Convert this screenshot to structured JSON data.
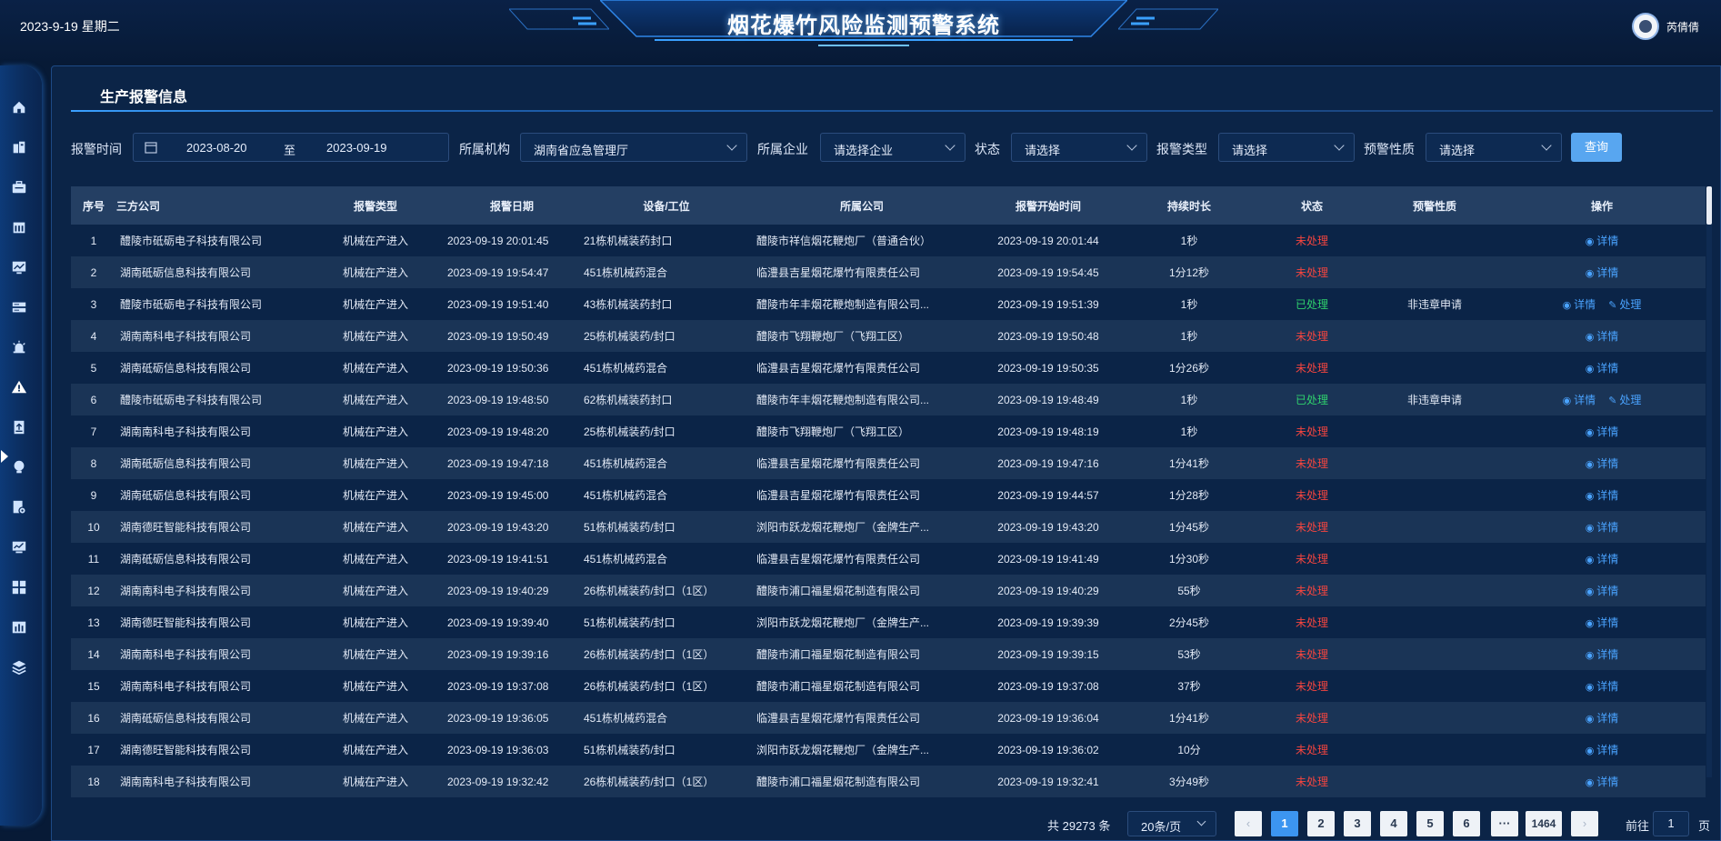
{
  "header": {
    "date": "2023-9-19 星期二",
    "title": "烟花爆竹风险监测预警系统",
    "username": "芮倩倩"
  },
  "sidebar": {
    "icons": [
      "home-icon",
      "building-icon",
      "briefcase-icon",
      "calendar-icon",
      "monitor-icon",
      "server-icon",
      "alarm-light-icon",
      "warning-icon",
      "document-upload-icon",
      "lightbulb-icon",
      "file-settings-icon",
      "dashboard-icon",
      "grid-icon",
      "bar-chart-icon",
      "layers-icon"
    ],
    "active_index": 7
  },
  "page": {
    "title": "生产报警信息"
  },
  "filters": {
    "time_label": "报警时间",
    "date_start": "2023-08-20",
    "date_sep": "至",
    "date_end": "2023-09-19",
    "org_label": "所属机构",
    "org_value": "湖南省应急管理厅",
    "company_label": "所属企业",
    "company_placeholder": "请选择企业",
    "status_label": "状态",
    "status_placeholder": "请选择",
    "type_label": "报警类型",
    "type_placeholder": "请选择",
    "nature_label": "预警性质",
    "nature_placeholder": "请选择",
    "query_button": "查询"
  },
  "table": {
    "columns": [
      "序号",
      "三方公司",
      "报警类型",
      "报警日期",
      "设备/工位",
      "所属公司",
      "报警开始时间",
      "持续时长",
      "状态",
      "预警性质",
      "操作"
    ],
    "detail_label": "详情",
    "process_label": "处理",
    "rows": [
      {
        "no": "1",
        "vendor": "醴陵市砥砺电子科技有限公司",
        "type": "机械在产进入",
        "date": "2023-09-19 20:01:45",
        "device": "21栋机械装药封口",
        "company": "醴陵市祥信烟花鞭炮厂（普通合伙）",
        "start": "2023-09-19 20:01:44",
        "duration": "1秒",
        "status": "未处理",
        "nature": ""
      },
      {
        "no": "2",
        "vendor": "湖南砥砺信息科技有限公司",
        "type": "机械在产进入",
        "date": "2023-09-19 19:54:47",
        "device": "451栋机械药混合",
        "company": "临澧县吉星烟花爆竹有限责任公司",
        "start": "2023-09-19 19:54:45",
        "duration": "1分12秒",
        "status": "未处理",
        "nature": ""
      },
      {
        "no": "3",
        "vendor": "醴陵市砥砺电子科技有限公司",
        "type": "机械在产进入",
        "date": "2023-09-19 19:51:40",
        "device": "43栋机械装药封口",
        "company": "醴陵市年丰烟花鞭炮制造有限公司...",
        "start": "2023-09-19 19:51:39",
        "duration": "1秒",
        "status": "已处理",
        "nature": "非违章申请"
      },
      {
        "no": "4",
        "vendor": "湖南南科电子科技有限公司",
        "type": "机械在产进入",
        "date": "2023-09-19 19:50:49",
        "device": "25栋机械装药/封口",
        "company": "醴陵市飞翔鞭炮厂（飞翔工区）",
        "start": "2023-09-19 19:50:48",
        "duration": "1秒",
        "status": "未处理",
        "nature": ""
      },
      {
        "no": "5",
        "vendor": "湖南砥砺信息科技有限公司",
        "type": "机械在产进入",
        "date": "2023-09-19 19:50:36",
        "device": "451栋机械药混合",
        "company": "临澧县吉星烟花爆竹有限责任公司",
        "start": "2023-09-19 19:50:35",
        "duration": "1分26秒",
        "status": "未处理",
        "nature": ""
      },
      {
        "no": "6",
        "vendor": "醴陵市砥砺电子科技有限公司",
        "type": "机械在产进入",
        "date": "2023-09-19 19:48:50",
        "device": "62栋机械装药封口",
        "company": "醴陵市年丰烟花鞭炮制造有限公司...",
        "start": "2023-09-19 19:48:49",
        "duration": "1秒",
        "status": "已处理",
        "nature": "非违章申请"
      },
      {
        "no": "7",
        "vendor": "湖南南科电子科技有限公司",
        "type": "机械在产进入",
        "date": "2023-09-19 19:48:20",
        "device": "25栋机械装药/封口",
        "company": "醴陵市飞翔鞭炮厂（飞翔工区）",
        "start": "2023-09-19 19:48:19",
        "duration": "1秒",
        "status": "未处理",
        "nature": ""
      },
      {
        "no": "8",
        "vendor": "湖南砥砺信息科技有限公司",
        "type": "机械在产进入",
        "date": "2023-09-19 19:47:18",
        "device": "451栋机械药混合",
        "company": "临澧县吉星烟花爆竹有限责任公司",
        "start": "2023-09-19 19:47:16",
        "duration": "1分41秒",
        "status": "未处理",
        "nature": ""
      },
      {
        "no": "9",
        "vendor": "湖南砥砺信息科技有限公司",
        "type": "机械在产进入",
        "date": "2023-09-19 19:45:00",
        "device": "451栋机械药混合",
        "company": "临澧县吉星烟花爆竹有限责任公司",
        "start": "2023-09-19 19:44:57",
        "duration": "1分28秒",
        "status": "未处理",
        "nature": ""
      },
      {
        "no": "10",
        "vendor": "湖南德旺智能科技有限公司",
        "type": "机械在产进入",
        "date": "2023-09-19 19:43:20",
        "device": "51栋机械装药/封口",
        "company": "浏阳市跃龙烟花鞭炮厂（金牌生产...",
        "start": "2023-09-19 19:43:20",
        "duration": "1分45秒",
        "status": "未处理",
        "nature": ""
      },
      {
        "no": "11",
        "vendor": "湖南砥砺信息科技有限公司",
        "type": "机械在产进入",
        "date": "2023-09-19 19:41:51",
        "device": "451栋机械药混合",
        "company": "临澧县吉星烟花爆竹有限责任公司",
        "start": "2023-09-19 19:41:49",
        "duration": "1分30秒",
        "status": "未处理",
        "nature": ""
      },
      {
        "no": "12",
        "vendor": "湖南南科电子科技有限公司",
        "type": "机械在产进入",
        "date": "2023-09-19 19:40:29",
        "device": "26栋机械装药/封口（1区）",
        "company": "醴陵市浦口福星烟花制造有限公司",
        "start": "2023-09-19 19:40:29",
        "duration": "55秒",
        "status": "未处理",
        "nature": ""
      },
      {
        "no": "13",
        "vendor": "湖南德旺智能科技有限公司",
        "type": "机械在产进入",
        "date": "2023-09-19 19:39:40",
        "device": "51栋机械装药/封口",
        "company": "浏阳市跃龙烟花鞭炮厂（金牌生产...",
        "start": "2023-09-19 19:39:39",
        "duration": "2分45秒",
        "status": "未处理",
        "nature": ""
      },
      {
        "no": "14",
        "vendor": "湖南南科电子科技有限公司",
        "type": "机械在产进入",
        "date": "2023-09-19 19:39:16",
        "device": "26栋机械装药/封口（1区）",
        "company": "醴陵市浦口福星烟花制造有限公司",
        "start": "2023-09-19 19:39:15",
        "duration": "53秒",
        "status": "未处理",
        "nature": ""
      },
      {
        "no": "15",
        "vendor": "湖南南科电子科技有限公司",
        "type": "机械在产进入",
        "date": "2023-09-19 19:37:08",
        "device": "26栋机械装药/封口（1区）",
        "company": "醴陵市浦口福星烟花制造有限公司",
        "start": "2023-09-19 19:37:08",
        "duration": "37秒",
        "status": "未处理",
        "nature": ""
      },
      {
        "no": "16",
        "vendor": "湖南砥砺信息科技有限公司",
        "type": "机械在产进入",
        "date": "2023-09-19 19:36:05",
        "device": "451栋机械药混合",
        "company": "临澧县吉星烟花爆竹有限责任公司",
        "start": "2023-09-19 19:36:04",
        "duration": "1分41秒",
        "status": "未处理",
        "nature": ""
      },
      {
        "no": "17",
        "vendor": "湖南德旺智能科技有限公司",
        "type": "机械在产进入",
        "date": "2023-09-19 19:36:03",
        "device": "51栋机械装药/封口",
        "company": "浏阳市跃龙烟花鞭炮厂（金牌生产...",
        "start": "2023-09-19 19:36:02",
        "duration": "10分",
        "status": "未处理",
        "nature": ""
      },
      {
        "no": "18",
        "vendor": "湖南南科电子科技有限公司",
        "type": "机械在产进入",
        "date": "2023-09-19 19:32:42",
        "device": "26栋机械装药/封口（1区）",
        "company": "醴陵市浦口福星烟花制造有限公司",
        "start": "2023-09-19 19:32:41",
        "duration": "3分49秒",
        "status": "未处理",
        "nature": ""
      }
    ]
  },
  "pagination": {
    "total_text": "共 29273 条",
    "page_size": "20条/页",
    "prev": "‹",
    "pages": [
      "1",
      "2",
      "3",
      "4",
      "5",
      "6"
    ],
    "ellipsis": "···",
    "last_page": "1464",
    "next": "›",
    "current": "1",
    "goto_label": "前往",
    "goto_value": "1",
    "page_word": "页"
  },
  "colors": {
    "background": "#071a36",
    "panel": "#0b2447",
    "accent": "#3c95f0",
    "unprocessed": "#f5453f",
    "processed": "#2fd16d",
    "link": "#4aa3ff"
  }
}
